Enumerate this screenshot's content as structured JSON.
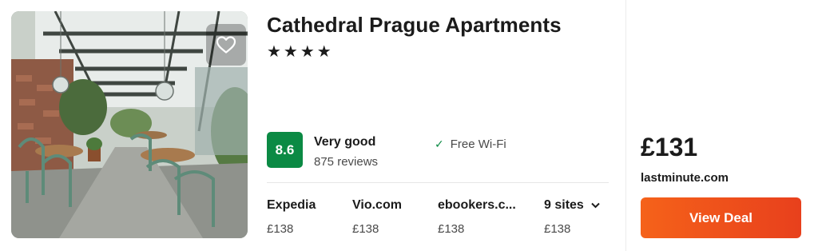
{
  "hotel": {
    "name": "Cathedral Prague Apartments",
    "stars": "★★★★",
    "favorite_icon": "heart-outline-icon"
  },
  "rating": {
    "score": "8.6",
    "label": "Very good",
    "reviews": "875 reviews",
    "badge_color": "#0b8a44"
  },
  "amenities": [
    {
      "icon": "check-icon",
      "label": "Free Wi-Fi"
    }
  ],
  "sites": [
    {
      "name": "Expedia",
      "price": "£138"
    },
    {
      "name": "Vio.com",
      "price": "£138"
    },
    {
      "name": "ebookers.c...",
      "price": "£138"
    },
    {
      "name": "9 sites",
      "price": "£138",
      "icon": "chevron-down-icon"
    }
  ],
  "deal": {
    "price": "£131",
    "site": "lastminute.com",
    "button_label": "View Deal",
    "button_color": "#f05a1b"
  }
}
